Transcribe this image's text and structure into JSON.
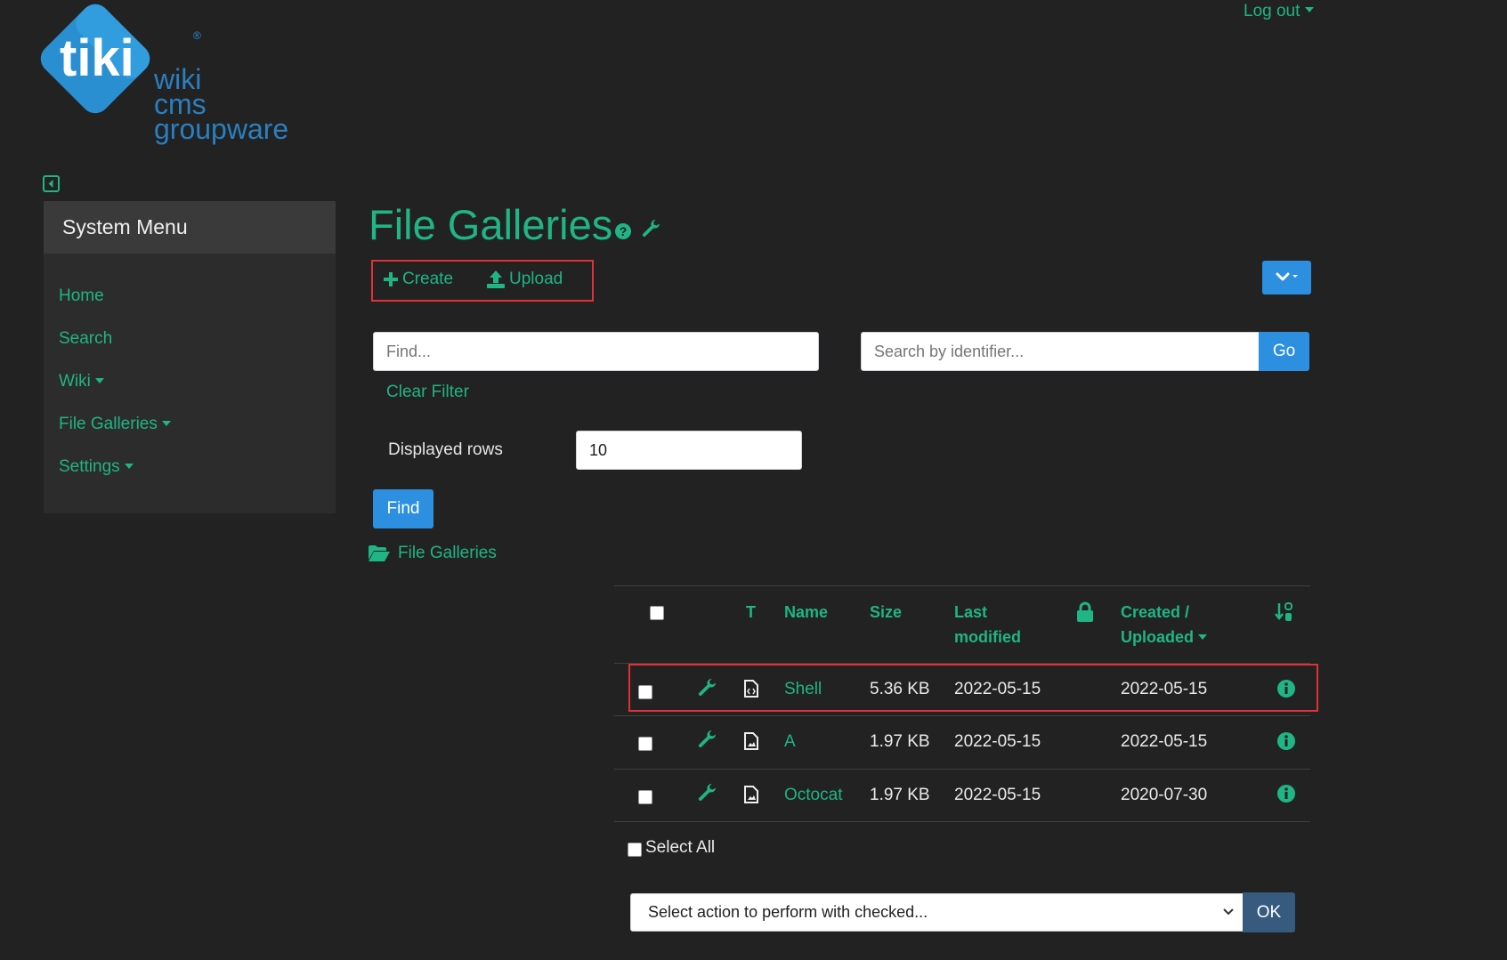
{
  "header": {
    "logo_text": "tiki",
    "logo_lines": [
      "wiki",
      "cms",
      "groupware"
    ],
    "logout_label": "Log out"
  },
  "sidebar": {
    "title": "System Menu",
    "items": [
      {
        "label": "Home",
        "has_caret": false
      },
      {
        "label": "Search",
        "has_caret": false
      },
      {
        "label": "Wiki",
        "has_caret": true
      },
      {
        "label": "File Galleries",
        "has_caret": true
      },
      {
        "label": "Settings",
        "has_caret": true
      }
    ]
  },
  "main": {
    "title": "File Galleries",
    "create_label": "Create",
    "upload_label": "Upload",
    "find_placeholder": "Find...",
    "id_placeholder": "Search by identifier...",
    "go_label": "Go",
    "clear_filter_label": "Clear Filter",
    "rows_label": "Displayed rows",
    "rows_value": "10",
    "find_button_label": "Find",
    "breadcrumb": "File Galleries"
  },
  "table": {
    "columns": {
      "type": "T",
      "name": "Name",
      "size": "Size",
      "last_modified_1": "Last",
      "last_modified_2": "modified",
      "created_1": "Created /",
      "created_2": "Uploaded"
    },
    "rows": [
      {
        "name": "Shell",
        "size": "5.36 KB",
        "modified": "2022-05-15",
        "created": "2022-05-15"
      },
      {
        "name": "A",
        "size": "1.97 KB",
        "modified": "2022-05-15",
        "created": "2022-05-15"
      },
      {
        "name": "Octocat",
        "size": "1.97 KB",
        "modified": "2022-05-15",
        "created": "2020-07-30"
      }
    ],
    "select_all_label": "Select All",
    "action_select": "Select action to perform with checked...",
    "ok_label": "OK"
  },
  "colors": {
    "accent": "#1fb585",
    "primary_button": "#2d8fe0",
    "highlight_border": "#e0303a",
    "background": "#222222"
  }
}
